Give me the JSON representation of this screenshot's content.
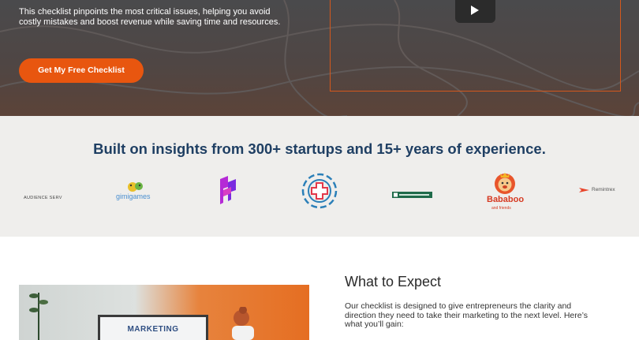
{
  "hero": {
    "description": "This checklist pinpoints the most critical issues, helping you avoid costly mistakes and boost revenue while saving time and resources.",
    "cta_label": "Get My Free Checklist",
    "accent_color": "#e8560f"
  },
  "video": {
    "play_icon": "play-icon"
  },
  "logos": {
    "title": "Built on insights from 300+ startups and 15+ years of experience.",
    "items": [
      {
        "name": "AUDIENCE SERV"
      },
      {
        "name": "gimigames"
      },
      {
        "name": "purple-logo"
      },
      {
        "name": "medical-cross-logo"
      },
      {
        "name": "green-badge-logo"
      },
      {
        "name": "Bababoo",
        "tagline": "and friends"
      },
      {
        "name": "Remintrex"
      }
    ]
  },
  "expect": {
    "image_board_text": "MARKETING",
    "heading": "What to Expect",
    "body": "Our checklist is designed to give entrepreneurs the clarity and direction they need to take their marketing to the next level. Here’s what you’ll gain:"
  }
}
